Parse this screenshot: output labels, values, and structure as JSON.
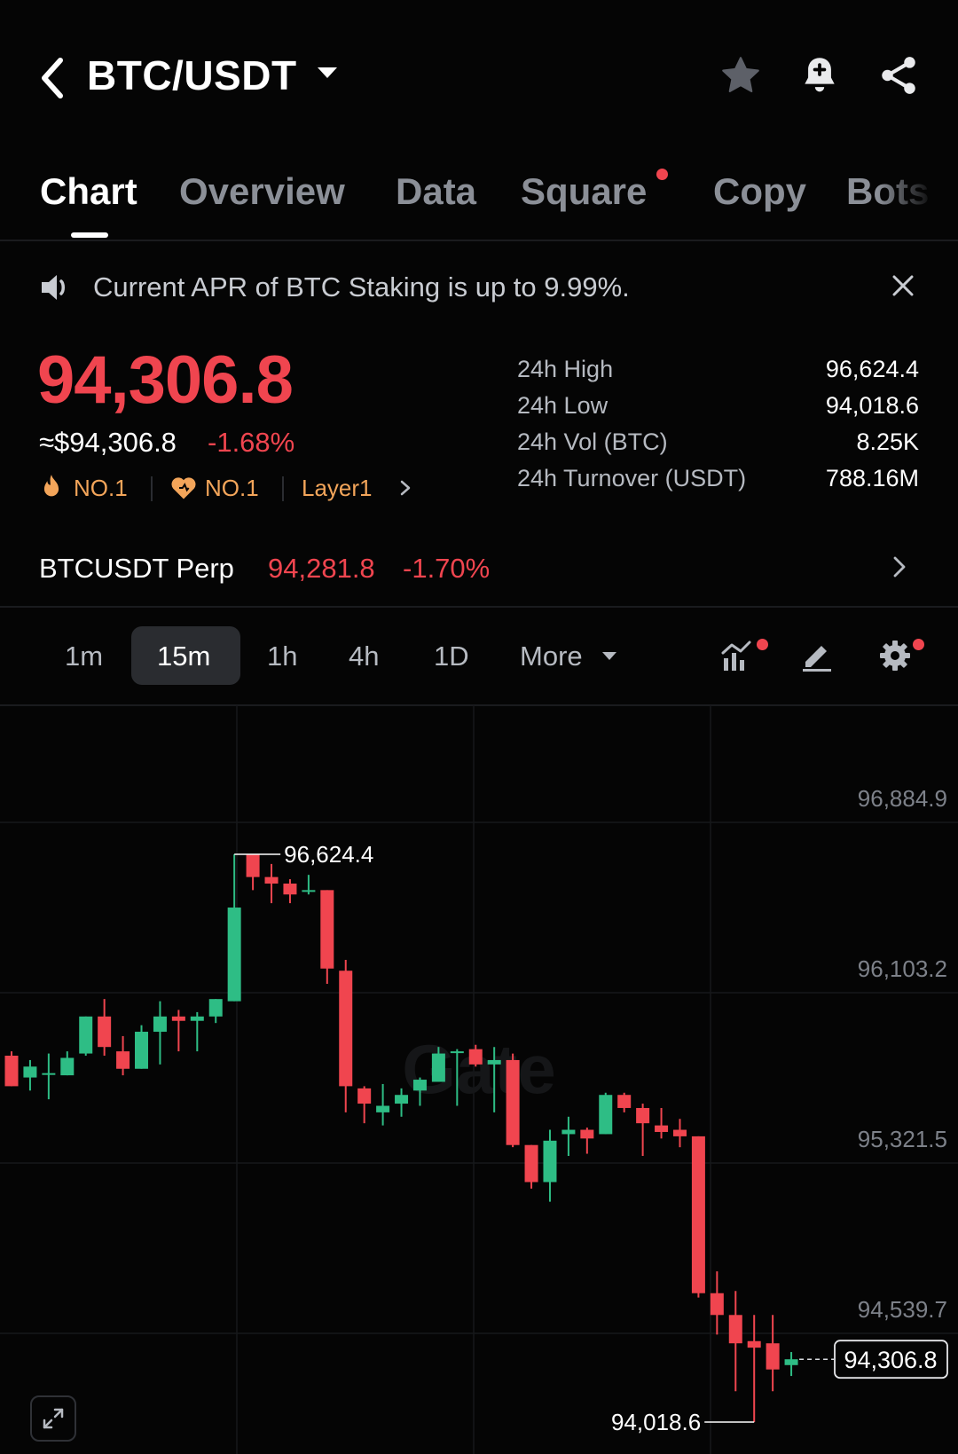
{
  "header": {
    "pair": "BTC/USDT",
    "icons": [
      "back-icon",
      "dropdown-caret-icon",
      "star-icon",
      "bell-plus-icon",
      "share-icon"
    ]
  },
  "tabs": [
    {
      "label": "Chart",
      "active": true
    },
    {
      "label": "Overview"
    },
    {
      "label": "Data"
    },
    {
      "label": "Square",
      "badge_dot": true
    },
    {
      "label": "Copy"
    },
    {
      "label": "Bots"
    }
  ],
  "banner": {
    "text": "Current APR of BTC Staking is up to 9.99%."
  },
  "ticker": {
    "last_price": "94,306.8",
    "usd_price": "≈$94,306.8",
    "change": "-1.68%",
    "ranks": [
      "NO.1",
      "NO.1"
    ],
    "category": "Layer1",
    "stats": [
      {
        "label": "24h High",
        "value": "96,624.4"
      },
      {
        "label": "24h Low",
        "value": "94,018.6"
      },
      {
        "label": "24h Vol (BTC)",
        "value": "8.25K"
      },
      {
        "label": "24h Turnover (USDT)",
        "value": "788.16M"
      }
    ]
  },
  "perp": {
    "name": "BTCUSDT Perp",
    "price": "94,281.8",
    "change": "-1.70%"
  },
  "intervals": {
    "options": [
      "1m",
      "15m",
      "1h",
      "4h",
      "1D"
    ],
    "selected": "15m",
    "more_label": "More"
  },
  "colors": {
    "up": "#2ebd85",
    "down": "#f0454f",
    "background": "#050505",
    "rank_orange": "#f3a55a"
  },
  "chart_data": {
    "type": "candlestick",
    "interval": "15m",
    "y_ticks": [
      "96,884.9",
      "96,103.2",
      "95,321.5",
      "94,539.7"
    ],
    "ylim": [
      93900,
      97200
    ],
    "high_marker": "96,624.4",
    "low_marker": "94,018.6",
    "last_price_label": "94,306.8",
    "watermark": "Gate",
    "candles": [
      {
        "o": 95700,
        "h": 95720,
        "l": 95560,
        "c": 95560
      },
      {
        "o": 95600,
        "h": 95680,
        "l": 95540,
        "c": 95650
      },
      {
        "o": 95620,
        "h": 95710,
        "l": 95500,
        "c": 95620
      },
      {
        "o": 95610,
        "h": 95720,
        "l": 95610,
        "c": 95690
      },
      {
        "o": 95710,
        "h": 95880,
        "l": 95700,
        "c": 95880
      },
      {
        "o": 95880,
        "h": 95960,
        "l": 95700,
        "c": 95740
      },
      {
        "o": 95720,
        "h": 95790,
        "l": 95610,
        "c": 95640
      },
      {
        "o": 95640,
        "h": 95840,
        "l": 95640,
        "c": 95810
      },
      {
        "o": 95810,
        "h": 95950,
        "l": 95660,
        "c": 95880
      },
      {
        "o": 95880,
        "h": 95910,
        "l": 95720,
        "c": 95860
      },
      {
        "o": 95860,
        "h": 95900,
        "l": 95720,
        "c": 95880
      },
      {
        "o": 95880,
        "h": 95960,
        "l": 95850,
        "c": 95960
      },
      {
        "o": 95950,
        "h": 96624.4,
        "l": 95950,
        "c": 96380
      },
      {
        "o": 96624.4,
        "h": 96624.4,
        "l": 96460,
        "c": 96520
      },
      {
        "o": 96520,
        "h": 96580,
        "l": 96400,
        "c": 96490
      },
      {
        "o": 96490,
        "h": 96510,
        "l": 96400,
        "c": 96440
      },
      {
        "o": 96460,
        "h": 96530,
        "l": 96440,
        "c": 96460
      },
      {
        "o": 96460,
        "h": 96460,
        "l": 96030,
        "c": 96100
      },
      {
        "o": 96090,
        "h": 96140,
        "l": 95440,
        "c": 95560
      },
      {
        "o": 95550,
        "h": 95560,
        "l": 95390,
        "c": 95480
      },
      {
        "o": 95440,
        "h": 95570,
        "l": 95380,
        "c": 95470
      },
      {
        "o": 95480,
        "h": 95550,
        "l": 95420,
        "c": 95520
      },
      {
        "o": 95540,
        "h": 95600,
        "l": 95470,
        "c": 95590
      },
      {
        "o": 95580,
        "h": 95740,
        "l": 95580,
        "c": 95710
      },
      {
        "o": 95720,
        "h": 95730,
        "l": 95470,
        "c": 95720
      },
      {
        "o": 95730,
        "h": 95750,
        "l": 95650,
        "c": 95660
      },
      {
        "o": 95660,
        "h": 95740,
        "l": 95440,
        "c": 95680
      },
      {
        "o": 95680,
        "h": 95710,
        "l": 95280,
        "c": 95290
      },
      {
        "o": 95290,
        "h": 95290,
        "l": 95090,
        "c": 95120
      },
      {
        "o": 95120,
        "h": 95360,
        "l": 95030,
        "c": 95310
      },
      {
        "o": 95340,
        "h": 95420,
        "l": 95240,
        "c": 95360
      },
      {
        "o": 95360,
        "h": 95370,
        "l": 95250,
        "c": 95320
      },
      {
        "o": 95340,
        "h": 95530,
        "l": 95340,
        "c": 95520
      },
      {
        "o": 95520,
        "h": 95530,
        "l": 95440,
        "c": 95460
      },
      {
        "o": 95460,
        "h": 95480,
        "l": 95240,
        "c": 95390
      },
      {
        "o": 95380,
        "h": 95460,
        "l": 95320,
        "c": 95350
      },
      {
        "o": 95360,
        "h": 95410,
        "l": 95280,
        "c": 95330
      },
      {
        "o": 95330,
        "h": 95330,
        "l": 94590,
        "c": 94610
      },
      {
        "o": 94610,
        "h": 94710,
        "l": 94420,
        "c": 94510
      },
      {
        "o": 94510,
        "h": 94620,
        "l": 94160,
        "c": 94380
      },
      {
        "o": 94390,
        "h": 94510,
        "l": 94018.6,
        "c": 94360
      },
      {
        "o": 94380,
        "h": 94510,
        "l": 94160,
        "c": 94260
      },
      {
        "o": 94280,
        "h": 94340,
        "l": 94230,
        "c": 94306.8
      }
    ]
  }
}
